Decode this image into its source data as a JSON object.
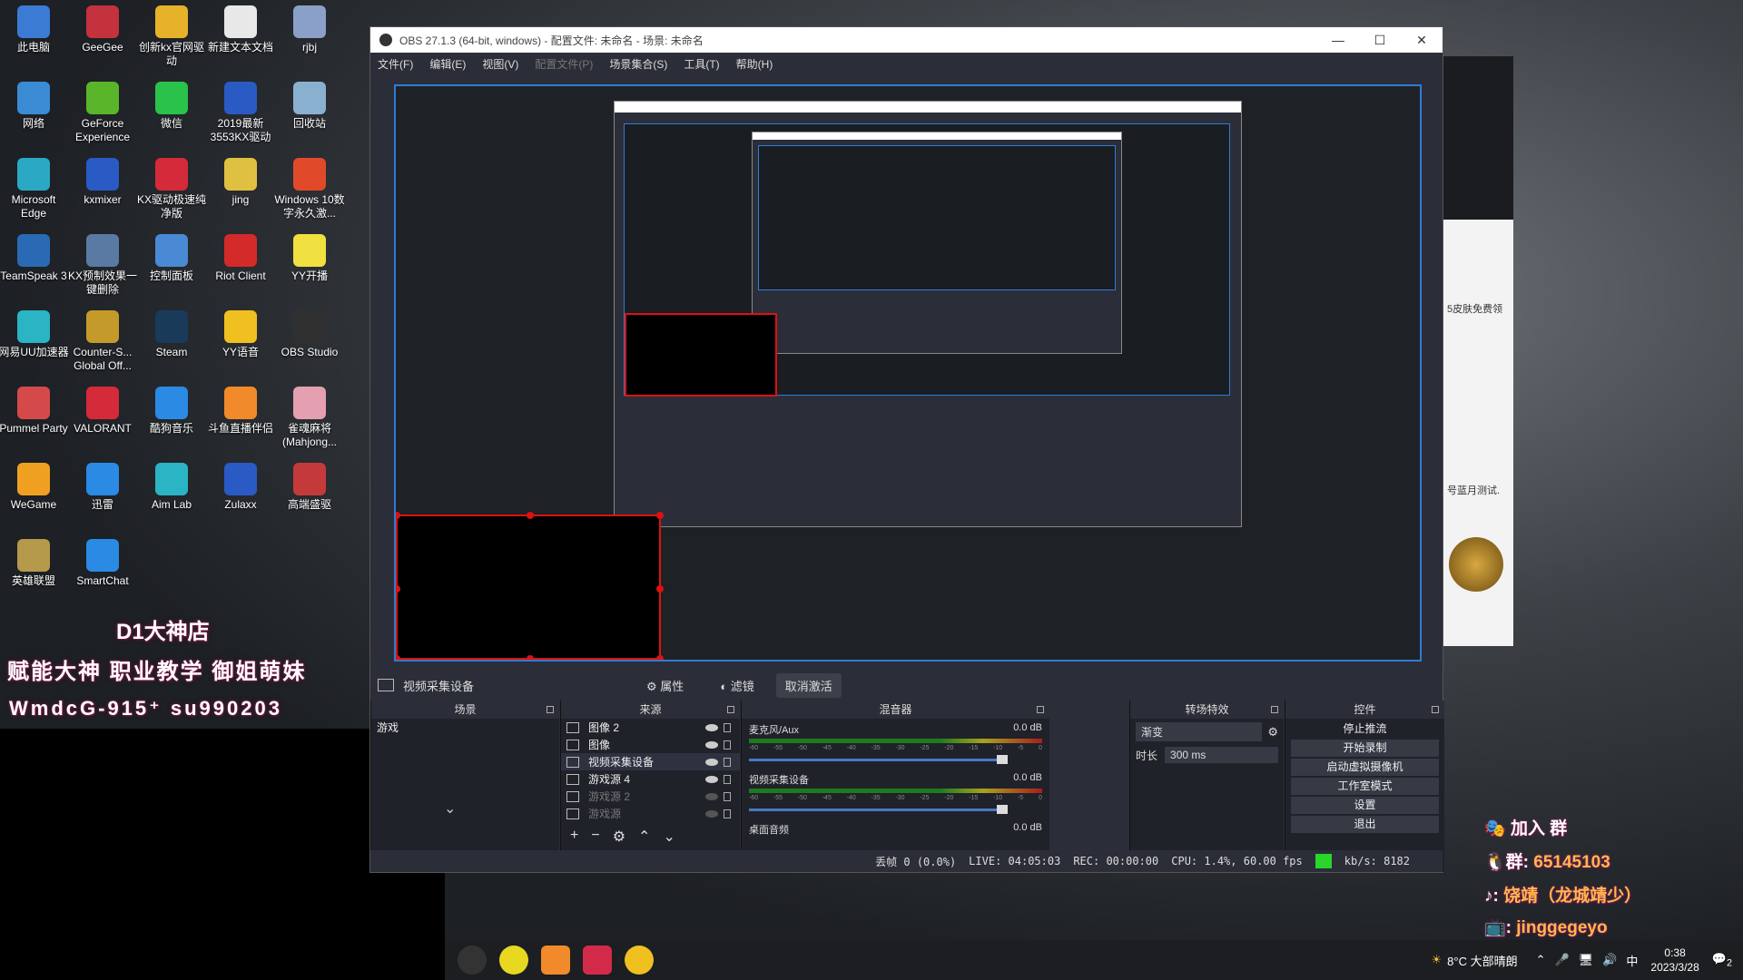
{
  "desktop": {
    "icons": [
      {
        "label": "此电脑",
        "color": "#3b7bd4"
      },
      {
        "label": "GeeGee",
        "color": "#c4323e"
      },
      {
        "label": "创新kx官网驱动",
        "color": "#e6b22a"
      },
      {
        "label": "新建文本文档",
        "color": "#e8e8e8"
      },
      {
        "label": "rjbj",
        "color": "#8aa0c8"
      },
      {
        "label": "网络",
        "color": "#3b8bd4"
      },
      {
        "label": "GeForce Experience",
        "color": "#5ab52a"
      },
      {
        "label": "微信",
        "color": "#2ac24a"
      },
      {
        "label": "2019最新3553KX驱动",
        "color": "#2a5ac4"
      },
      {
        "label": "回收站",
        "color": "#8ab0d0"
      },
      {
        "label": "Microsoft Edge",
        "color": "#2aa8c4"
      },
      {
        "label": "kxmixer",
        "color": "#2a5ac4"
      },
      {
        "label": "KX驱动极速纯净版",
        "color": "#d42a3a"
      },
      {
        "label": "jing",
        "color": "#e0c040"
      },
      {
        "label": "Windows 10数字永久激...",
        "color": "#e04a2a"
      },
      {
        "label": "TeamSpeak 3",
        "color": "#2a6ab4"
      },
      {
        "label": "KX预制效果一键删除",
        "color": "#5a7aa4"
      },
      {
        "label": "控制面板",
        "color": "#4a8ad4"
      },
      {
        "label": "Riot Client",
        "color": "#d42a2a"
      },
      {
        "label": "YY开播",
        "color": "#f0e040"
      },
      {
        "label": "网易UU加速器",
        "color": "#2ab4c4"
      },
      {
        "label": "Counter-S... Global Off...",
        "color": "#c49a2a"
      },
      {
        "label": "Steam",
        "color": "#1a3a5a"
      },
      {
        "label": "YY语音",
        "color": "#f0c020"
      },
      {
        "label": "OBS Studio",
        "color": "#303030"
      },
      {
        "label": "Pummel Party",
        "color": "#d44a4a"
      },
      {
        "label": "VALORANT",
        "color": "#d42a3a"
      },
      {
        "label": "酷狗音乐",
        "color": "#2a8ae4"
      },
      {
        "label": "斗鱼直播伴侣",
        "color": "#f08a2a"
      },
      {
        "label": "雀魂麻将(Mahjong...",
        "color": "#e4a0b0"
      },
      {
        "label": "WeGame",
        "color": "#f0a020"
      },
      {
        "label": "迅雷",
        "color": "#2a8ae4"
      },
      {
        "label": "Aim Lab",
        "color": "#2ab4c4"
      },
      {
        "label": "Zulaxx",
        "color": "#2a5ac4"
      },
      {
        "label": "高端盛驱",
        "color": "#c43a3a"
      },
      {
        "label": "英雄联盟",
        "color": "#b49a4a"
      },
      {
        "label": "SmartChat",
        "color": "#2a8ae4"
      }
    ],
    "overlay_line1": "D1大神店",
    "overlay_line2": "赋能大神 职业教学 御姐萌妹",
    "overlay_line3": "WmdcG-915⁺ su990203"
  },
  "obs": {
    "title": "OBS 27.1.3 (64-bit, windows) - 配置文件: 未命名 - 场景: 未命名",
    "window_buttons": [
      "—",
      "☐",
      "✕"
    ],
    "menu": [
      "文件(F)",
      "编辑(E)",
      "视图(V)",
      "配置文件(P)",
      "场景集合(S)",
      "工具(T)",
      "帮助(H)"
    ],
    "selected_source": "视频采集设备",
    "btn_properties": "属性",
    "btn_filters": "滤镜",
    "btn_deactivate": "取消激活",
    "panels": {
      "scenes": {
        "title": "场景",
        "items": [
          "游戏"
        ]
      },
      "sources": {
        "title": "来源",
        "items": [
          {
            "name": "图像 2",
            "visible": true
          },
          {
            "name": "图像",
            "visible": true
          },
          {
            "name": "视频采集设备",
            "visible": true
          },
          {
            "name": "游戏源 4",
            "visible": true
          },
          {
            "name": "游戏源 2",
            "visible": false
          },
          {
            "name": "游戏源",
            "visible": false
          }
        ]
      },
      "mixer": {
        "title": "混音器",
        "channels": [
          {
            "name": "麦克风/Aux",
            "db": "0.0 dB"
          },
          {
            "name": "视频采集设备",
            "db": "0.0 dB"
          },
          {
            "name": "桌面音频",
            "db": "0.0 dB"
          }
        ],
        "scale": [
          "-60",
          "-55",
          "-50",
          "-45",
          "-40",
          "-35",
          "-30",
          "-25",
          "-20",
          "-15",
          "-10",
          "-5",
          "0"
        ]
      },
      "transitions": {
        "title": "转场特效",
        "type": "渐变",
        "duration_label": "时长",
        "duration": "300 ms"
      },
      "controls": {
        "title": "控件",
        "buttons": [
          "停止推流",
          "开始录制",
          "启动虚拟摄像机",
          "工作室模式",
          "设置",
          "退出"
        ]
      }
    },
    "status": {
      "dropped": "丢帧 0 (0.0%)",
      "live": "LIVE: 04:05:03",
      "rec": "REC: 00:00:00",
      "cpu": "CPU: 1.4%, 60.00 fps",
      "kbps": "kb/s: 8182"
    }
  },
  "overlay_right": {
    "line1": "加入 群",
    "line2_label": "群: ",
    "line2_value": "65145103",
    "line3_label": ": ",
    "line3_value": "饶靖（龙城靖少）",
    "line4_label": ": ",
    "line4_value": "jinggegeyo"
  },
  "side_panel": {
    "text1": "5皮肤免费领",
    "text2": "号蓝月测试."
  },
  "taskbar": {
    "weather": "8°C 大部晴朗",
    "time": "0:38",
    "date": "2023/3/28",
    "ime": "中",
    "notif": "2"
  }
}
